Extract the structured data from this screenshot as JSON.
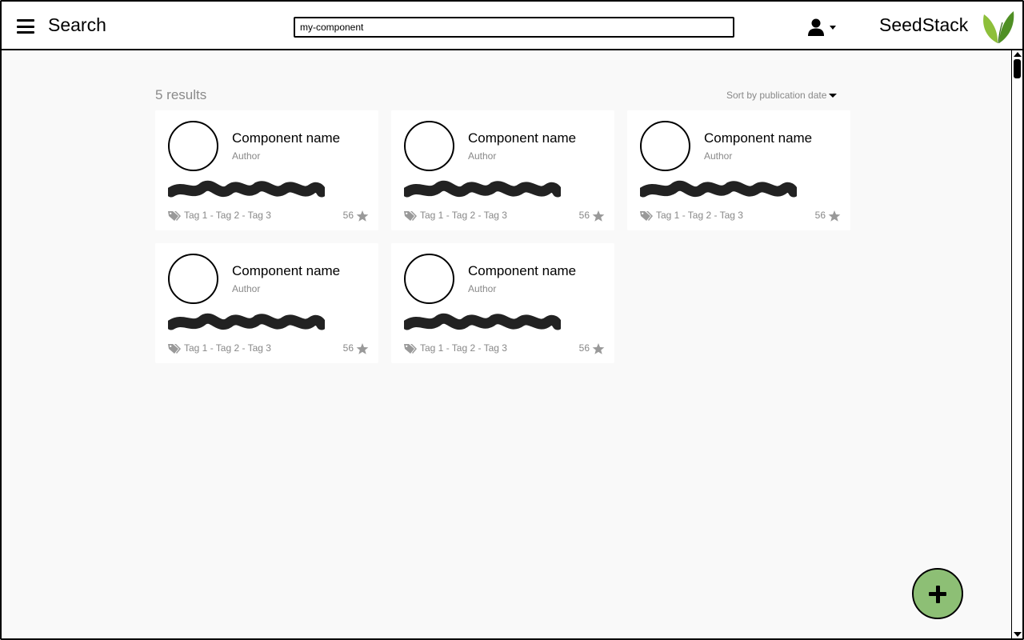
{
  "header": {
    "title": "Search",
    "search": {
      "value": "my-component",
      "placeholder": ""
    },
    "brand": "SeedStack",
    "icons": {
      "menu": "hamburger-icon",
      "user": "user-icon",
      "logo": "seedstack-leaf-logo"
    }
  },
  "results": {
    "count_label": "5 results",
    "sort_label": "Sort by publication date",
    "cards": [
      {
        "name": "Component name",
        "author": "Author",
        "tags": "Tag 1 - Tag 2 - Tag 3",
        "stars": "56"
      },
      {
        "name": "Component name",
        "author": "Author",
        "tags": "Tag 1 - Tag 2 - Tag 3",
        "stars": "56"
      },
      {
        "name": "Component name",
        "author": "Author",
        "tags": "Tag 1 - Tag 2 - Tag 3",
        "stars": "56"
      },
      {
        "name": "Component name",
        "author": "Author",
        "tags": "Tag 1 - Tag 2 - Tag 3",
        "stars": "56"
      },
      {
        "name": "Component name",
        "author": "Author",
        "tags": "Tag 1 - Tag 2 - Tag 3",
        "stars": "56"
      }
    ]
  },
  "fab": {
    "icon": "plus-icon"
  },
  "colors": {
    "fab": "#8dbf75",
    "muted_text": "#888888",
    "card_bg": "#ffffff",
    "page_bg": "#f9f9f9"
  }
}
